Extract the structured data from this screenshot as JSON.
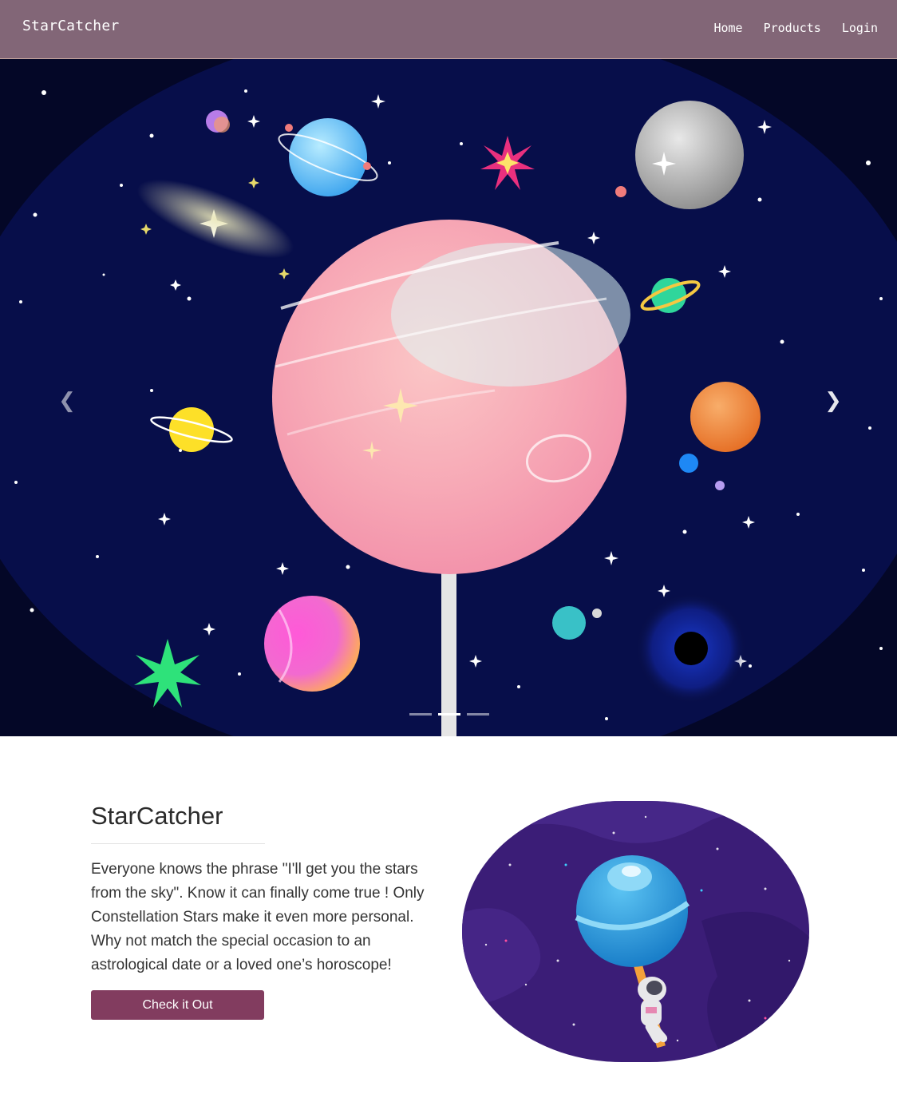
{
  "navbar": {
    "brand": "StarCatcher",
    "links": [
      {
        "label": "Home"
      },
      {
        "label": "Products"
      },
      {
        "label": "Login"
      }
    ],
    "background": "#826677"
  },
  "carousel": {
    "prev_icon": "chevron-left-icon",
    "next_icon": "chevron-right-icon",
    "prev_glyph": "❮",
    "next_glyph": "❯",
    "slides_count": 3,
    "active_slide": 2
  },
  "feature": {
    "title": "StarCatcher",
    "description": "Everyone knows the phrase \"I'll get you the stars from the sky\". Know it can finally come true ! Only Constellation Stars make it even more personal. Why not match the special occasion to an astrological date or a loved one’s horoscope!",
    "button_label": "Check it Out",
    "button_color": "#823c5f"
  }
}
